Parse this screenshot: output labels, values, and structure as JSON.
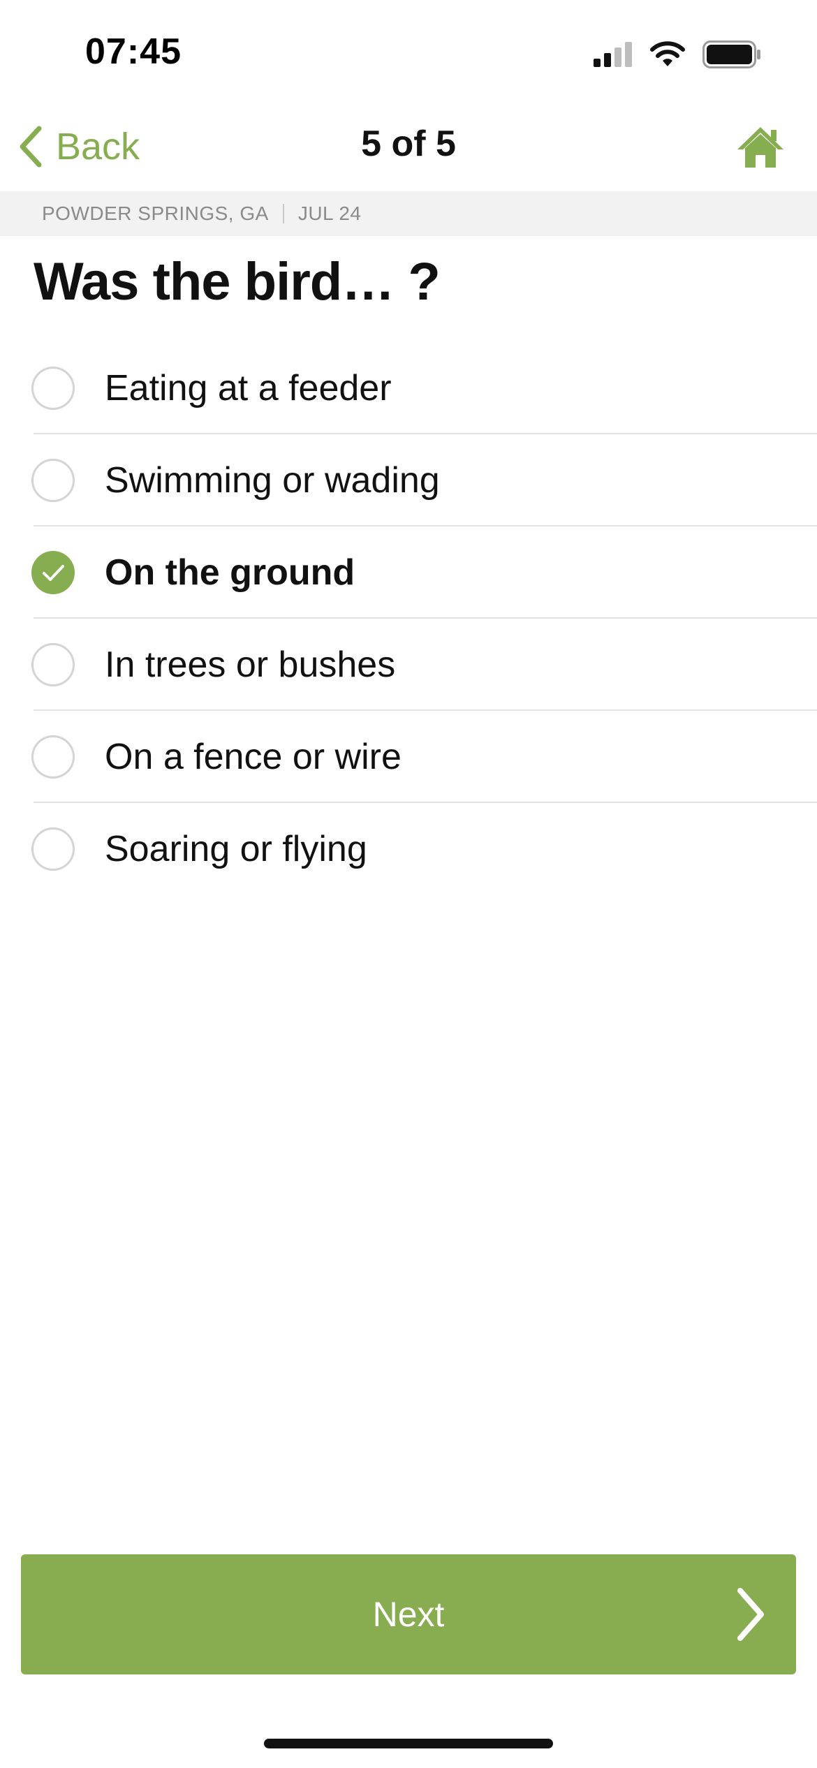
{
  "status_bar": {
    "time": "07:45",
    "icons": [
      "cellular-signal-icon",
      "wifi-icon",
      "battery-icon"
    ]
  },
  "nav": {
    "back_label": "Back",
    "title": "5 of 5",
    "home_icon": "home-icon"
  },
  "info": {
    "location": "POWDER SPRINGS, GA",
    "date": "JUL 24"
  },
  "question": {
    "title": "Was the bird… ?"
  },
  "options": [
    {
      "label": "Eating at a feeder",
      "selected": false
    },
    {
      "label": "Swimming or wading",
      "selected": false
    },
    {
      "label": "On the ground",
      "selected": true
    },
    {
      "label": "In trees or bushes",
      "selected": false
    },
    {
      "label": "On a fence or wire",
      "selected": false
    },
    {
      "label": "Soaring or flying",
      "selected": false
    }
  ],
  "footer": {
    "next_label": "Next"
  },
  "colors": {
    "accent": "#86ad4f",
    "button": "#88ad50",
    "strip_bg": "#f2f2f2",
    "divider": "#e3e3e3"
  }
}
